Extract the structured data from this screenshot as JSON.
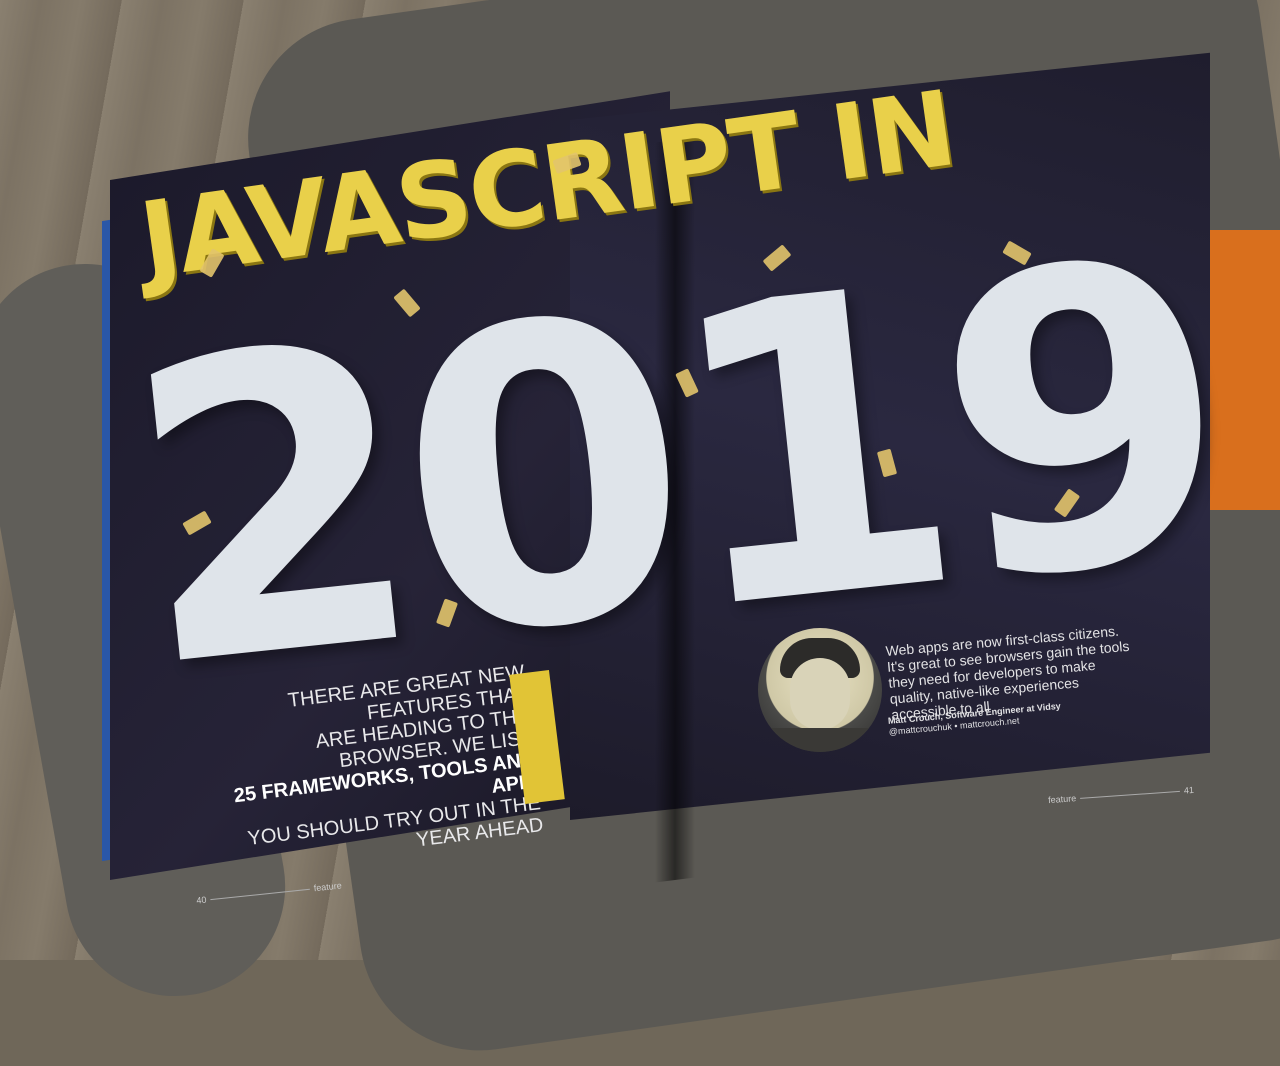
{
  "magazine": {
    "headline_top": "JAVASCRIPT IN",
    "headline_year": "2019",
    "intro_line1": "THERE ARE GREAT NEW FEATURES THAT",
    "intro_line2": "ARE HEADING TO THE BROWSER. WE LIST",
    "intro_line3": "25 FRAMEWORKS, TOOLS AND APIs",
    "intro_line4": "YOU SHOULD TRY OUT IN THE YEAR AHEAD",
    "quote": "Web apps are now first-class citizens. It's great to see browsers gain the tools they need for developers to make quality, native-like experiences accessible to all",
    "quote_author": "Matt Crouch, Software Engineer at Vidsy",
    "quote_handle": "@mattcrouchuk",
    "quote_separator": "•",
    "quote_site": "mattcrouch.net",
    "folio_left_number": "40",
    "folio_left_label": "feature",
    "folio_right_label": "feature",
    "folio_right_number": "41"
  },
  "colors": {
    "page_background": "#1c1a2a",
    "headline_yellow": "#e9d04a",
    "year_white": "#dfe4ea",
    "sofa": "#5b5954",
    "pillow": "#d96f1d",
    "floor": "#7c7263"
  }
}
